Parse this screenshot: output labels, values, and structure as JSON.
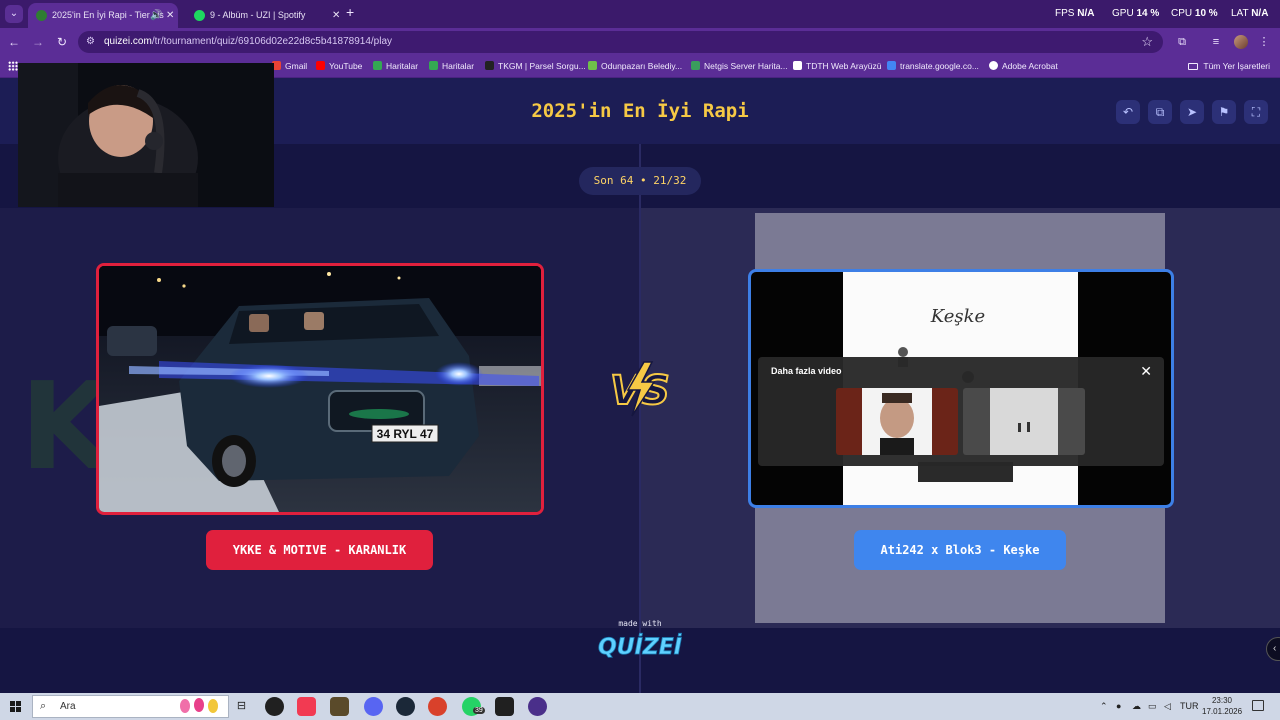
{
  "browser": {
    "tabs": [
      {
        "title": "2025'in En İyi Rapi - Tier Lis",
        "active": true,
        "audio_icon": "speaker-icon"
      },
      {
        "title": "9 - Albüm - UZI | Spotify",
        "active": false
      }
    ],
    "new_tab": "+",
    "stats": {
      "fps_label": "FPS",
      "fps_value": "N/A",
      "gpu_label": "GPU",
      "gpu_value": "14 %",
      "cpu_label": "CPU",
      "cpu_value": "10 %",
      "lat_label": "LAT",
      "lat_value": "N/A"
    },
    "url_host": "quizei.com",
    "url_path": "/tr/tournament/quiz/69106d02e22d8c5b41878914/play",
    "bookmarks": [
      {
        "label": "Gmail",
        "color": "#ea4335"
      },
      {
        "label": "YouTube",
        "color": "#ff0000"
      },
      {
        "label": "Haritalar",
        "color": "#34a853"
      },
      {
        "label": "Haritalar",
        "color": "#34a853"
      },
      {
        "label": "TKGM | Parsel Sorgu...",
        "color": "#222222"
      },
      {
        "label": "Odunpazarı Belediy...",
        "color": "#6fbf4a"
      },
      {
        "label": "Netgis Server Harita...",
        "color": "#3a9d5d"
      },
      {
        "label": "TDTH Web Arayüzü",
        "color": "#ffffff"
      },
      {
        "label": "translate.google.co...",
        "color": "#4285f4"
      },
      {
        "label": "Adobe Acrobat",
        "color": "#ffffff"
      }
    ],
    "all_bookmarks": "Tüm Yer İşaretleri"
  },
  "quiz": {
    "title": "2025'in En İyi Rapi",
    "round": "Son 64 • 21/32",
    "left": {
      "label": "YKKE & MOTIVE - KARANLIK",
      "plate": "34 RYL 47",
      "accent": "#e0203d"
    },
    "right": {
      "label": "Ati242 x Blok3 - Keşke",
      "cover_text": "Keşke",
      "accent": "#3f86ee",
      "overlay_title": "Daha fazla video",
      "overlay_close": "✕"
    },
    "vs_text": "VS",
    "made_with": "made with",
    "brand": "QUİZEİ",
    "toolbar_icons": [
      "undo-icon",
      "share-icon",
      "send-icon",
      "flag-icon",
      "fullscreen-icon"
    ]
  },
  "taskbar": {
    "search_placeholder": "Ara",
    "whatsapp_badge": "39",
    "language": "TUR",
    "time": "23:30",
    "date": "17.01.2026"
  }
}
